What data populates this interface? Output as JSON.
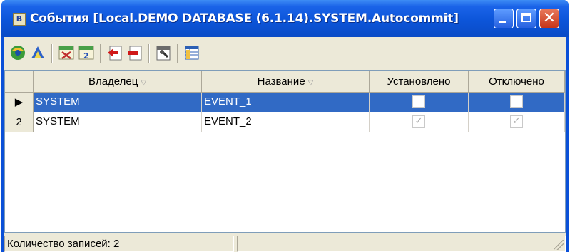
{
  "window": {
    "title": "События [Local.DEMO DATABASE (6.1.14).SYSTEM.Autocommit]",
    "icon_glyph": "B",
    "buttons": {
      "minimize": "minimize-icon",
      "maximize": "maximize-icon",
      "close": "close-icon"
    },
    "colors": {
      "titlebar": "#0c55d9",
      "selection": "#316ac5",
      "face": "#ece9d8"
    }
  },
  "toolbar": {
    "buttons": [
      {
        "name": "refresh-icon"
      },
      {
        "name": "filter-icon"
      },
      {
        "name": "enable-events-icon"
      },
      {
        "name": "disable-events-icon"
      },
      {
        "name": "add-record-icon"
      },
      {
        "name": "delete-record-icon"
      },
      {
        "name": "properties-icon"
      },
      {
        "name": "table-view-icon"
      }
    ]
  },
  "grid": {
    "columns": [
      "Владелец",
      "Название",
      "Установлено",
      "Отключено"
    ],
    "sort_indicator": "▽",
    "rows": [
      {
        "indicator": "▶",
        "owner": "SYSTEM",
        "name": "EVENT_1",
        "installed": false,
        "disabled": false,
        "selected": true
      },
      {
        "indicator": "2",
        "owner": "SYSTEM",
        "name": "EVENT_2",
        "installed": true,
        "disabled": true,
        "selected": false
      }
    ]
  },
  "status": {
    "record_count_text": "Количество записей: 2"
  }
}
